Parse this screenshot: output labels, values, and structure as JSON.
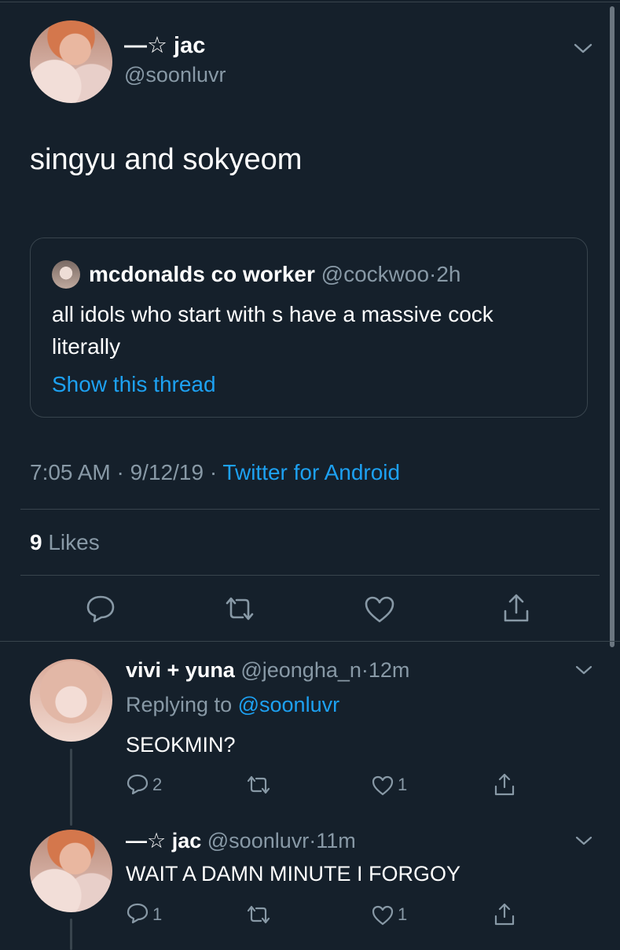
{
  "main_tweet": {
    "display_name": "—☆ jac",
    "handle": "@soonluvr",
    "text": "singyu and sokyeom",
    "quoted": {
      "display_name": "mcdonalds co worker",
      "handle": "@cockwoo",
      "separator": "·",
      "time": "2h",
      "text_line1": "all idols who start with s have a massive cock",
      "text_line2": "literally",
      "show_thread": "Show this thread"
    },
    "timestamp": "7:05 AM · 9/12/19 ·",
    "source": "Twitter for Android",
    "likes_count": "9",
    "likes_label": "Likes"
  },
  "replies": [
    {
      "display_name": "vivi + yuna",
      "handle": "@jeongha_n",
      "separator": "·",
      "time": "12m",
      "replying_label": "Replying to",
      "replying_handle": "@soonluvr",
      "text": "SEOKMIN?",
      "reply_count": "2",
      "retweet_count": "",
      "like_count": "1"
    },
    {
      "display_name": "—☆ jac",
      "handle": "@soonluvr",
      "separator": "·",
      "time": "11m",
      "text": "WAIT A DAMN MINUTE I FORGOY",
      "reply_count": "1",
      "retweet_count": "",
      "like_count": "1"
    }
  ],
  "colors": {
    "background": "#15202b",
    "text": "#ffffff",
    "secondary": "#8899a6",
    "accent": "#1da1f2",
    "divider": "#38444d"
  },
  "icons": [
    "reply-icon",
    "retweet-icon",
    "like-icon",
    "share-icon",
    "chevron-down-icon"
  ]
}
